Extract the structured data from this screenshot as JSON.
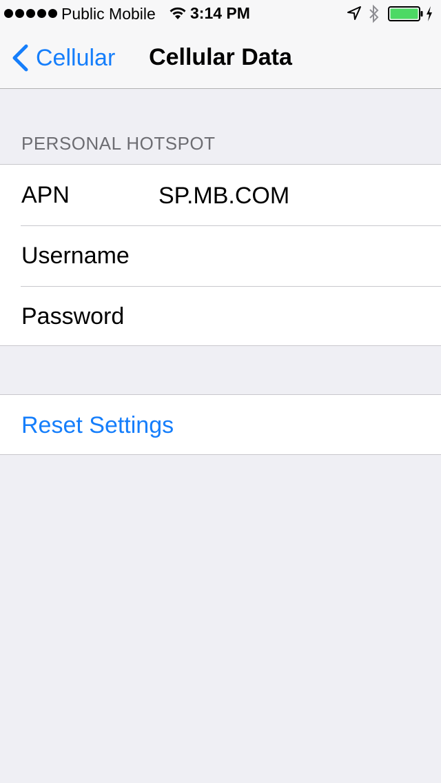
{
  "status_bar": {
    "signal_dots": 5,
    "carrier": "Public Mobile",
    "time": "3:14 PM",
    "battery_color": "#4cd964"
  },
  "nav": {
    "back_label": "Cellular",
    "title": "Cellular Data"
  },
  "personal_hotspot": {
    "header": "PERSONAL HOTSPOT",
    "rows": [
      {
        "label": "APN",
        "value": "SP.MB.COM"
      },
      {
        "label": "Username",
        "value": ""
      },
      {
        "label": "Password",
        "value": ""
      }
    ]
  },
  "reset": {
    "label": "Reset Settings"
  },
  "colors": {
    "accent": "#157efb",
    "background": "#efeff4"
  }
}
